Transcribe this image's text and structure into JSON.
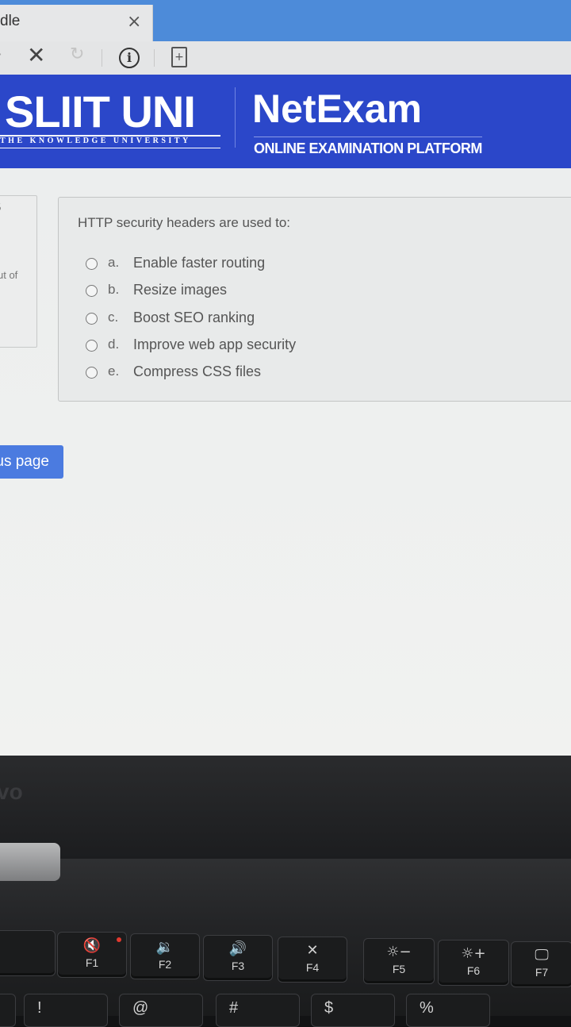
{
  "browser": {
    "tab_title": "dle",
    "tab_close_glyph": "×",
    "icons": [
      "back-arrow-icon",
      "stop-icon",
      "reload-icon",
      "info-icon",
      "page-icon"
    ]
  },
  "banner": {
    "logo": "SLIIT UNI",
    "logo_tagline": "THE KNOWLEDGE UNIVERSITY",
    "title": "NetExam",
    "subtitle": "ONLINE EXAMINATION PLATFORM"
  },
  "nav_fragment": {
    "number": "5",
    "text": "ut of"
  },
  "question": {
    "text": "HTTP security headers are used to:",
    "options": [
      {
        "letter": "a.",
        "text": "Enable faster routing"
      },
      {
        "letter": "b.",
        "text": "Resize images"
      },
      {
        "letter": "c.",
        "text": "Boost SEO ranking"
      },
      {
        "letter": "d.",
        "text": "Improve web app security"
      },
      {
        "letter": "e.",
        "text": "Compress CSS files"
      }
    ]
  },
  "prev_button": "us page",
  "laptop": {
    "brand": "vo",
    "fkeys": [
      {
        "label": "",
        "icon": ""
      },
      {
        "label": "F1",
        "icon": "🔇"
      },
      {
        "label": "F2",
        "icon": "🔉"
      },
      {
        "label": "F3",
        "icon": "🔊"
      },
      {
        "label": "F4",
        "icon": "✕"
      },
      {
        "label": "F5",
        "icon": "☼−"
      },
      {
        "label": "F6",
        "icon": "☼+"
      },
      {
        "label": "F7",
        "icon": "🖵"
      }
    ],
    "lower_keys": [
      "",
      "!",
      "@",
      "#",
      "$",
      "%"
    ]
  },
  "colors": {
    "banner": "#2b47c9",
    "tabstrip": "#4d8bd9",
    "button": "#4b7be0"
  }
}
